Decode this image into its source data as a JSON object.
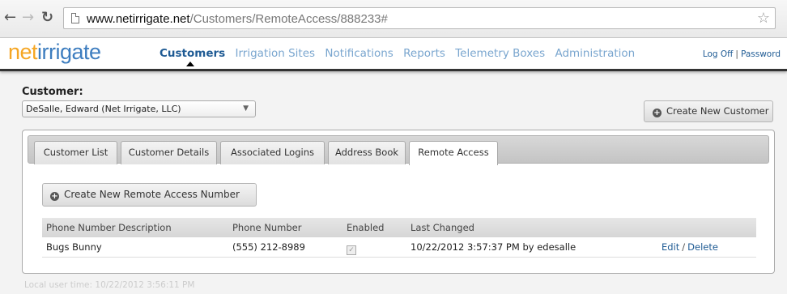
{
  "browser": {
    "url_host": "www.netirrigate.net",
    "url_path": "/Customers/RemoteAccess/888233#"
  },
  "header": {
    "logo_part1": "net",
    "logo_part2": "irrigate",
    "nav": [
      {
        "label": "Customers",
        "active": true
      },
      {
        "label": "Irrigation Sites"
      },
      {
        "label": "Notifications"
      },
      {
        "label": "Reports"
      },
      {
        "label": "Telemetry Boxes"
      },
      {
        "label": "Administration"
      }
    ],
    "logoff": "Log Off",
    "password": "Password",
    "separator": "|"
  },
  "customer": {
    "label": "Customer:",
    "selected": "DeSalle, Edward (Net Irrigate, LLC)",
    "create_button": "Create New Customer"
  },
  "tabs": [
    "Customer List",
    "Customer Details",
    "Associated Logins",
    "Address Book",
    "Remote Access"
  ],
  "remote": {
    "create_button": "Create New Remote Access Number",
    "columns": [
      "Phone Number Description",
      "Phone Number",
      "Enabled",
      "Last Changed"
    ],
    "rows": [
      {
        "description": "Bugs Bunny",
        "phone": "(555) 212-8989",
        "enabled": true,
        "last_changed": "10/22/2012 3:57:37 PM by edesalle",
        "edit": "Edit",
        "delete": "Delete",
        "sep": "/"
      }
    ]
  },
  "footer": {
    "local_time": "Local user time: 10/22/2012 3:56:11 PM"
  },
  "colors": {
    "logo_orange": "#f5a623",
    "logo_blue": "#3d7dbf",
    "nav_active": "#1f5b94",
    "nav_inactive": "#7aa6cf"
  }
}
